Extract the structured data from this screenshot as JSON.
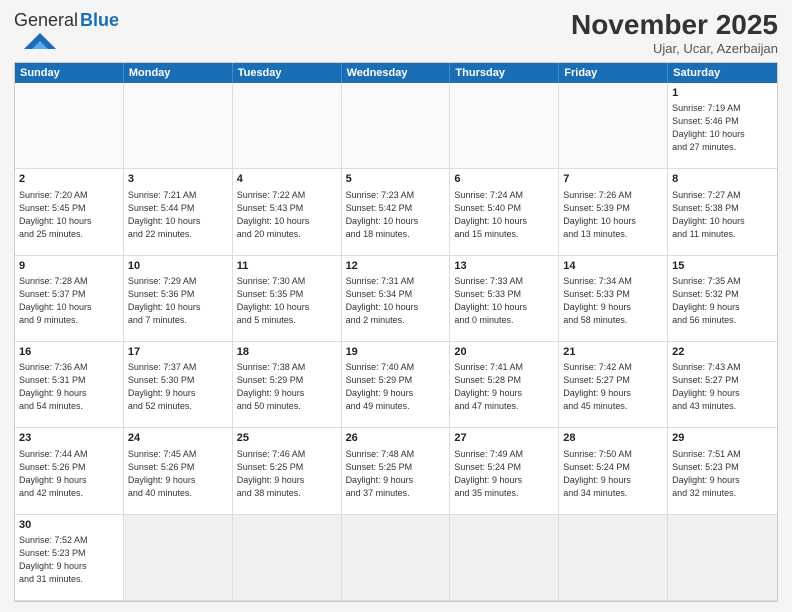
{
  "logo": {
    "general": "General",
    "blue": "Blue"
  },
  "header": {
    "month": "November 2025",
    "location": "Ujar, Ucar, Azerbaijan"
  },
  "days": [
    "Sunday",
    "Monday",
    "Tuesday",
    "Wednesday",
    "Thursday",
    "Friday",
    "Saturday"
  ],
  "cells": [
    {
      "day": null,
      "info": ""
    },
    {
      "day": null,
      "info": ""
    },
    {
      "day": null,
      "info": ""
    },
    {
      "day": null,
      "info": ""
    },
    {
      "day": null,
      "info": ""
    },
    {
      "day": null,
      "info": ""
    },
    {
      "day": "1",
      "info": "Sunrise: 7:19 AM\nSunset: 5:46 PM\nDaylight: 10 hours\nand 27 minutes."
    },
    {
      "day": "2",
      "info": "Sunrise: 7:20 AM\nSunset: 5:45 PM\nDaylight: 10 hours\nand 25 minutes."
    },
    {
      "day": "3",
      "info": "Sunrise: 7:21 AM\nSunset: 5:44 PM\nDaylight: 10 hours\nand 22 minutes."
    },
    {
      "day": "4",
      "info": "Sunrise: 7:22 AM\nSunset: 5:43 PM\nDaylight: 10 hours\nand 20 minutes."
    },
    {
      "day": "5",
      "info": "Sunrise: 7:23 AM\nSunset: 5:42 PM\nDaylight: 10 hours\nand 18 minutes."
    },
    {
      "day": "6",
      "info": "Sunrise: 7:24 AM\nSunset: 5:40 PM\nDaylight: 10 hours\nand 15 minutes."
    },
    {
      "day": "7",
      "info": "Sunrise: 7:26 AM\nSunset: 5:39 PM\nDaylight: 10 hours\nand 13 minutes."
    },
    {
      "day": "8",
      "info": "Sunrise: 7:27 AM\nSunset: 5:38 PM\nDaylight: 10 hours\nand 11 minutes."
    },
    {
      "day": "9",
      "info": "Sunrise: 7:28 AM\nSunset: 5:37 PM\nDaylight: 10 hours\nand 9 minutes."
    },
    {
      "day": "10",
      "info": "Sunrise: 7:29 AM\nSunset: 5:36 PM\nDaylight: 10 hours\nand 7 minutes."
    },
    {
      "day": "11",
      "info": "Sunrise: 7:30 AM\nSunset: 5:35 PM\nDaylight: 10 hours\nand 5 minutes."
    },
    {
      "day": "12",
      "info": "Sunrise: 7:31 AM\nSunset: 5:34 PM\nDaylight: 10 hours\nand 2 minutes."
    },
    {
      "day": "13",
      "info": "Sunrise: 7:33 AM\nSunset: 5:33 PM\nDaylight: 10 hours\nand 0 minutes."
    },
    {
      "day": "14",
      "info": "Sunrise: 7:34 AM\nSunset: 5:33 PM\nDaylight: 9 hours\nand 58 minutes."
    },
    {
      "day": "15",
      "info": "Sunrise: 7:35 AM\nSunset: 5:32 PM\nDaylight: 9 hours\nand 56 minutes."
    },
    {
      "day": "16",
      "info": "Sunrise: 7:36 AM\nSunset: 5:31 PM\nDaylight: 9 hours\nand 54 minutes."
    },
    {
      "day": "17",
      "info": "Sunrise: 7:37 AM\nSunset: 5:30 PM\nDaylight: 9 hours\nand 52 minutes."
    },
    {
      "day": "18",
      "info": "Sunrise: 7:38 AM\nSunset: 5:29 PM\nDaylight: 9 hours\nand 50 minutes."
    },
    {
      "day": "19",
      "info": "Sunrise: 7:40 AM\nSunset: 5:29 PM\nDaylight: 9 hours\nand 49 minutes."
    },
    {
      "day": "20",
      "info": "Sunrise: 7:41 AM\nSunset: 5:28 PM\nDaylight: 9 hours\nand 47 minutes."
    },
    {
      "day": "21",
      "info": "Sunrise: 7:42 AM\nSunset: 5:27 PM\nDaylight: 9 hours\nand 45 minutes."
    },
    {
      "day": "22",
      "info": "Sunrise: 7:43 AM\nSunset: 5:27 PM\nDaylight: 9 hours\nand 43 minutes."
    },
    {
      "day": "23",
      "info": "Sunrise: 7:44 AM\nSunset: 5:26 PM\nDaylight: 9 hours\nand 42 minutes."
    },
    {
      "day": "24",
      "info": "Sunrise: 7:45 AM\nSunset: 5:26 PM\nDaylight: 9 hours\nand 40 minutes."
    },
    {
      "day": "25",
      "info": "Sunrise: 7:46 AM\nSunset: 5:25 PM\nDaylight: 9 hours\nand 38 minutes."
    },
    {
      "day": "26",
      "info": "Sunrise: 7:48 AM\nSunset: 5:25 PM\nDaylight: 9 hours\nand 37 minutes."
    },
    {
      "day": "27",
      "info": "Sunrise: 7:49 AM\nSunset: 5:24 PM\nDaylight: 9 hours\nand 35 minutes."
    },
    {
      "day": "28",
      "info": "Sunrise: 7:50 AM\nSunset: 5:24 PM\nDaylight: 9 hours\nand 34 minutes."
    },
    {
      "day": "29",
      "info": "Sunrise: 7:51 AM\nSunset: 5:23 PM\nDaylight: 9 hours\nand 32 minutes."
    },
    {
      "day": "30",
      "info": "Sunrise: 7:52 AM\nSunset: 5:23 PM\nDaylight: 9 hours\nand 31 minutes."
    },
    {
      "day": null,
      "info": ""
    },
    {
      "day": null,
      "info": ""
    },
    {
      "day": null,
      "info": ""
    },
    {
      "day": null,
      "info": ""
    },
    {
      "day": null,
      "info": ""
    },
    {
      "day": null,
      "info": ""
    }
  ]
}
